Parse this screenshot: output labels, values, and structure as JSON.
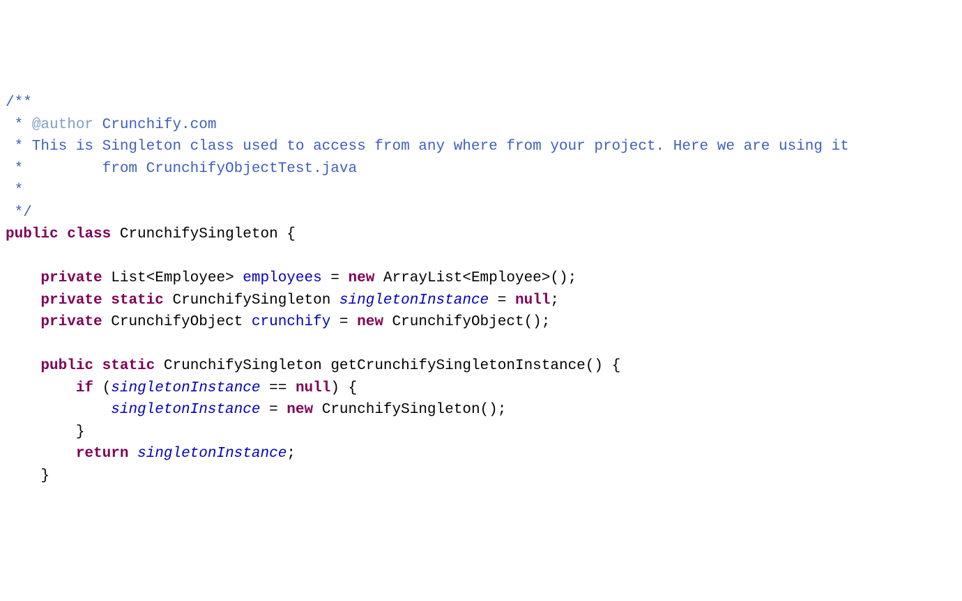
{
  "code": {
    "l1_a": "/**",
    "l2_a": " * ",
    "l2_b": "@author",
    "l2_c": " Crunchify.com",
    "l3_a": " * This is Singleton class used to access from any where from your project. Here we are using it",
    "l4_a": " *         from ",
    "l4_b": "CrunchifyObjectTest.java",
    "l5_a": " * ",
    "l6_a": " */",
    "l7_a": "public",
    "l7_b": " ",
    "l7_c": "class",
    "l7_d": " CrunchifySingleton {",
    "l8_a": "",
    "l9_a": "    ",
    "l9_b": "private",
    "l9_c": " List<Employee> ",
    "l9_d": "employees",
    "l9_e": " = ",
    "l9_f": "new",
    "l9_g": " ArrayList<Employee>();",
    "l10_a": "    ",
    "l10_b": "private",
    "l10_c": " ",
    "l10_d": "static",
    "l10_e": " CrunchifySingleton ",
    "l10_f": "singletonInstance",
    "l10_g": " = ",
    "l10_h": "null",
    "l10_i": ";",
    "l11_a": "    ",
    "l11_b": "private",
    "l11_c": " CrunchifyObject ",
    "l11_d": "crunchify",
    "l11_e": " = ",
    "l11_f": "new",
    "l11_g": " CrunchifyObject();",
    "l12_a": "",
    "l13_a": "    ",
    "l13_b": "public",
    "l13_c": " ",
    "l13_d": "static",
    "l13_e": " CrunchifySingleton getCrunchifySingletonInstance() {",
    "l14_a": "        ",
    "l14_b": "if",
    "l14_c": " (",
    "l14_d": "singletonInstance",
    "l14_e": " == ",
    "l14_f": "null",
    "l14_g": ") {",
    "l15_a": "            ",
    "l15_b": "singletonInstance",
    "l15_c": " = ",
    "l15_d": "new",
    "l15_e": " CrunchifySingleton();",
    "l16_a": "        }",
    "l17_a": "        ",
    "l17_b": "return",
    "l17_c": " ",
    "l17_d": "singletonInstance",
    "l17_e": ";",
    "l18_a": "    }"
  }
}
